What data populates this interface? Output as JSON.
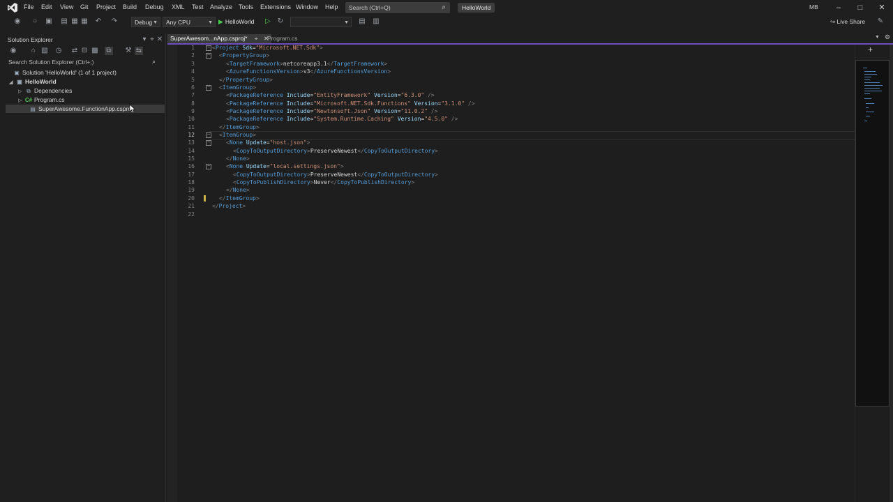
{
  "menubar": {
    "items": [
      "File",
      "Edit",
      "View",
      "Git",
      "Project",
      "Build",
      "Debug",
      "XML",
      "Test",
      "Analyze",
      "Tools",
      "Extensions",
      "Window",
      "Help"
    ],
    "search_placeholder": "Search (Ctrl+Q)",
    "project_badge": "HelloWorld",
    "avatar_initials": "MB"
  },
  "toolbar": {
    "configuration": "Debug",
    "platform": "Any CPU",
    "run_target": "HelloWorld",
    "live_share": "Live Share"
  },
  "solution_explorer": {
    "title": "Solution Explorer",
    "search_placeholder": "Search Solution Explorer (Ctrl+;)",
    "items": [
      {
        "label": "Solution 'HelloWorld' (1 of 1 project)",
        "icon": "solution-icon"
      },
      {
        "label": "HelloWorld",
        "icon": "csharp-project-icon"
      },
      {
        "label": "Dependencies",
        "icon": "dependencies-icon"
      },
      {
        "label": "Program.cs",
        "icon": "csharp-file-icon",
        "icon_text": "C#"
      },
      {
        "label": "SuperAwesome.FunctionApp.csproj",
        "icon": "project-file-icon"
      }
    ]
  },
  "editor": {
    "tabs": [
      {
        "label": "SuperAwesom...nApp.csproj*",
        "active": true
      },
      {
        "label": "Program.cs",
        "active": false
      }
    ],
    "current_line": 12,
    "line_numbers": [
      "1",
      "2",
      "3",
      "4",
      "5",
      "6",
      "7",
      "8",
      "9",
      "10",
      "11",
      "12",
      "13",
      "14",
      "15",
      "16",
      "17",
      "18",
      "19",
      "20",
      "21",
      "22"
    ]
  },
  "colors": {
    "accent": "#6c4fb9",
    "tag": "#569cd6",
    "attr": "#9cdcfe",
    "string": "#ce9178",
    "text": "#d4d4d4"
  }
}
